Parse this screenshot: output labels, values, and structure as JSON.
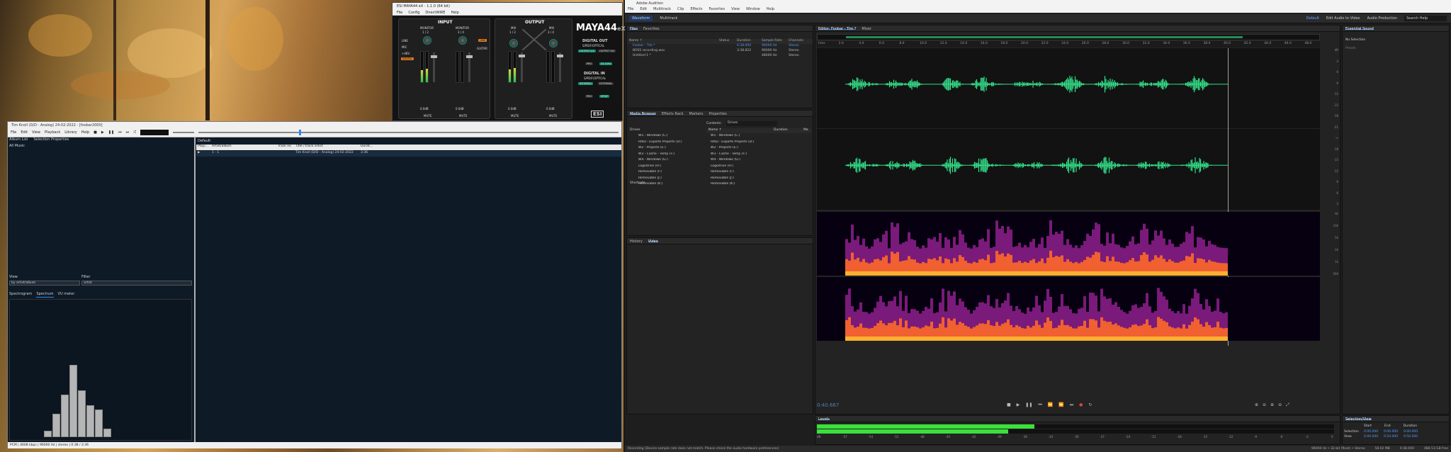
{
  "maya": {
    "title": "ESI MAYA44 eX - 1.1.0 (64 bit)",
    "menu": [
      "File",
      "Config",
      "DirectWIRE",
      "Help"
    ],
    "input_label": "INPUT",
    "output_label": "OUTPUT",
    "brand": "MAYA44",
    "brand_suffix": "eX",
    "monitor_labels": [
      "MONITOR",
      "MONITOR"
    ],
    "monitor_ch": [
      "1 / 2",
      "3 / 4"
    ],
    "mix_labels": [
      "MIX",
      "MIX"
    ],
    "mix_ch": [
      "1 / 2",
      "3 / 4"
    ],
    "input_side": [
      "LINE",
      "MIC",
      "+48V",
      "DIGITAL"
    ],
    "line_btn": "LINE",
    "guitar": "GUITAR",
    "mute": "MUTE",
    "db_zero": "0.0dB",
    "digital_out": "DIGITAL OUT",
    "digital_out_sub": "S/PDIF/OPTICAL",
    "output_12": "OUTPUT 1/2",
    "output_34": "OUTPUT 3/4",
    "digital_in": "DIGITAL IN",
    "digital_in_sub": "S/PDIF/OPTICAL",
    "bypass": "INTERNAL",
    "sync": "EXTERNAL",
    "samplerate": "44.1kHz",
    "level_label": "SPDIF",
    "pro": "PRO",
    "esi_logo": "ESI"
  },
  "foobar": {
    "title": "Tim Knoll (D/D - Analog) 24-02-2022 - [foobar2000]",
    "menu": [
      "File",
      "Edit",
      "View",
      "Playback",
      "Library",
      "Help"
    ],
    "tabs": [
      "Album List",
      "Selection Properties"
    ],
    "tree_root": "All Music",
    "playlist_tab": "Default",
    "columns": [
      "Playi...",
      "Artist/album",
      "Track no",
      "Title / track artist",
      "Durat..."
    ],
    "row": {
      "track": "1 - 1",
      "title": "Tim Knoll (D/D - Analog) 24-02-2022",
      "duration": "3:36"
    },
    "view_label": "View",
    "view_value": "by artist/album",
    "filter_label": "Filter",
    "filter_value": "artist",
    "viz_tabs": [
      "Spectrogram",
      "Spectrum",
      "VU meter"
    ],
    "status": "PCM | 4608 kbps | 96000 Hz | stereo | 0:38 / 3:36",
    "spectrum_bars": [
      0.06,
      0.22,
      0.4,
      0.68,
      0.44,
      0.3,
      0.26,
      0.08
    ]
  },
  "audition": {
    "title": "Adobe Audition",
    "menu": [
      "File",
      "Edit",
      "Multitrack",
      "Clip",
      "Effects",
      "Favorites",
      "View",
      "Window",
      "Help"
    ],
    "toolbar_modes": [
      "Waveform",
      "Multitrack"
    ],
    "workspace": [
      "Default",
      "Edit Audio to Video",
      "Audio Production"
    ],
    "search": "Search Help",
    "files_tabs": [
      "Files",
      "Favorites"
    ],
    "files_cols": [
      "Name ↑",
      "Status",
      "Duration",
      "Sample Rate",
      "Channels"
    ],
    "files": [
      {
        "name": "Foobar - Tim *",
        "duration": "0:38.000",
        "rate": "96000 Hz",
        "ch": "Stereo"
      },
      {
        "name": "BOSS recording.wav",
        "duration": "3:38.822",
        "rate": "96000 Hz",
        "ch": "Stereo"
      },
      {
        "name": "Untitled 1 *",
        "duration": "",
        "rate": "48000 Hz",
        "ch": "Stereo"
      }
    ],
    "mb_tabs": [
      "Media Browser",
      "Effects Rack",
      "Markers",
      "Properties"
    ],
    "drives_label": "Drives",
    "contents_label": "Contents:",
    "contents_value": "Drives",
    "mb_cols": [
      "Name ↑",
      "Duration",
      "Ma"
    ],
    "drives": [
      "W1 - Windows (C:)",
      "RAID - Exports Projects (D:)",
      "W2 - Projects (E:)",
      "W3 - Cache - Temp (F:)",
      "W4 - Windows (G:)",
      "Logodrive (H:)",
      "Removable (I:)",
      "Removable (J:)",
      "Removable (K:)"
    ],
    "shortcuts": "Shortcuts",
    "history_tabs": [
      "History",
      "Video"
    ],
    "editor_tabs": [
      "Editor: Foobar - Tim *",
      "Mixer"
    ],
    "ruler": [
      "hms",
      "2.0",
      "4.0",
      "6.0",
      "8.0",
      "10.0",
      "12.0",
      "14.0",
      "16.0",
      "18.0",
      "20.0",
      "22.0",
      "24.0",
      "26.0",
      "28.0",
      "30.0",
      "32.0",
      "34.0",
      "36.0",
      "38.0",
      "40.0",
      "42.0",
      "44.0",
      "46.0",
      "48.0"
    ],
    "db_scale": [
      "dB",
      "-3",
      "-6",
      "-9",
      "-12",
      "-15",
      "-18",
      "-21",
      "-∞",
      "-18",
      "-15",
      "-12",
      "-9",
      "-6",
      "-3"
    ],
    "hz_scale": [
      "Hz",
      "10k",
      "5k",
      "2k",
      "1k",
      "500"
    ],
    "timecode": "0:40.667",
    "levels_tab": "Levels",
    "level_scale": [
      "dB",
      "-57",
      "-54",
      "-51",
      "-48",
      "-45",
      "-42",
      "-39",
      "-36",
      "-33",
      "-30",
      "-27",
      "-24",
      "-21",
      "-18",
      "-15",
      "-12",
      "-9",
      "-6",
      "-3",
      "0"
    ],
    "level_values": [
      0.42,
      0.37
    ],
    "status_msg": "Recording (Device sample rate does not match. Please check the audio hardware preferences)",
    "status_info": [
      "96000 Hz • 32-bit (float) • Stereo",
      "58.02 MB",
      "0:38.000",
      "488.53 GB free"
    ],
    "essential_sound": "Essential Sound",
    "no_selection": "No Selection",
    "preset": "Preset:",
    "sel_title": "Selection/View",
    "sel_cols": [
      "Start",
      "End",
      "Duration"
    ],
    "sel_rows": [
      {
        "label": "Selection",
        "start": "0:00.000",
        "end": "0:00.000",
        "dur": "0:00.000"
      },
      {
        "label": "View",
        "start": "0:00.000",
        "end": "0:50.000",
        "dur": "0:50.000"
      }
    ],
    "accent_green": "#33e08a",
    "level_green": "#3be03b",
    "blue": "#2b87ff"
  }
}
